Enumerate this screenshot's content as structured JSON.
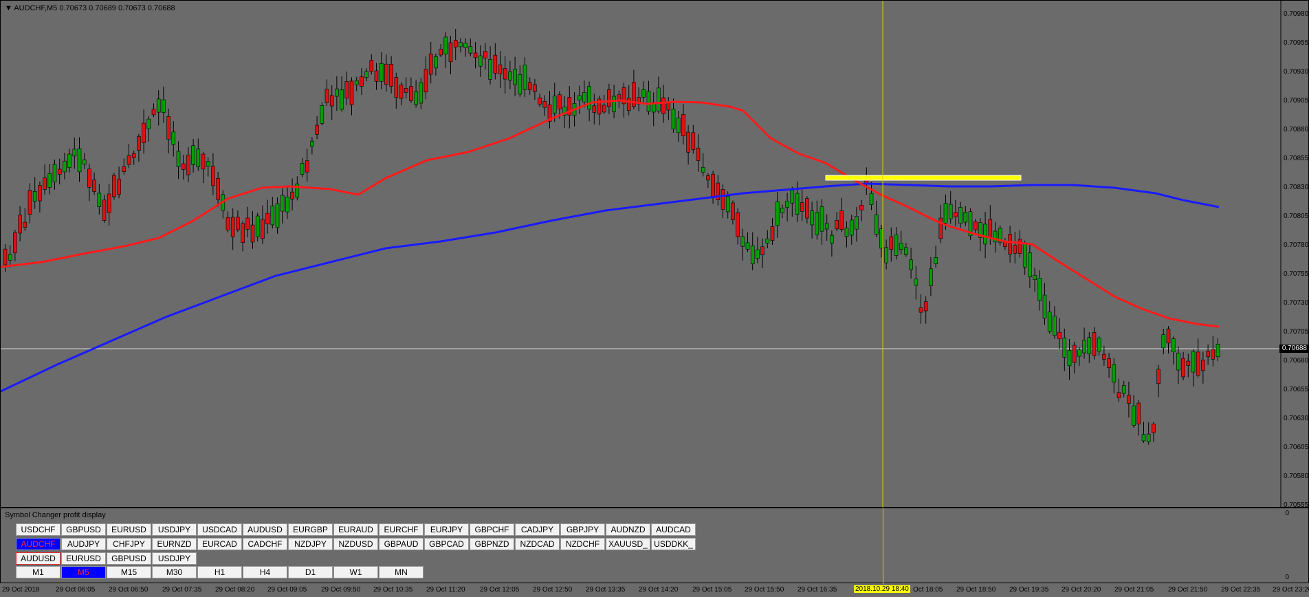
{
  "chart": {
    "title": "AUDCHF,M5  0.70673 0.70689 0.70673 0.70688",
    "price_axis": [
      "0.70980",
      "0.70955",
      "0.70930",
      "0.70905",
      "0.70880",
      "0.70855",
      "0.70830",
      "0.70805",
      "0.70780",
      "0.70755",
      "0.70730",
      "0.70705",
      "0.70680",
      "0.70655",
      "0.70630",
      "0.70605",
      "0.70580",
      "0.70555"
    ],
    "current_price": "0.70688",
    "colors": {
      "background": "#6b6b6b",
      "bull": "#00a000",
      "bear": "#e01010",
      "ma_fast": "#ff1a1a",
      "ma_slow": "#1a1aff",
      "highlight": "#ffff00"
    }
  },
  "panel": {
    "title": "Symbol Changer profit display",
    "scale_top": "0",
    "scale_bottom": "0",
    "row1": [
      "USDCHF",
      "GBPUSD",
      "EURUSD",
      "USDJPY",
      "USDCAD",
      "AUDUSD",
      "EURGBP",
      "EURAUD",
      "EURCHF",
      "EURJPY",
      "GBPCHF",
      "CADJPY",
      "GBPJPY",
      "AUDNZD",
      "AUDCAD"
    ],
    "row2": [
      "AUDCHF",
      "AUDJPY",
      "CHFJPY",
      "EURNZD",
      "EURCAD",
      "CADCHF",
      "NZDJPY",
      "NZDUSD",
      "GBPAUD",
      "GBPCAD",
      "GBPNZD",
      "NZDCAD",
      "NZDCHF",
      "XAUUSD_",
      "USDDKK_"
    ],
    "row3": [
      "AUDUSD",
      "EURUSD",
      "GBPUSD",
      "USDJPY"
    ],
    "timeframes": [
      "M1",
      "M5",
      "M15",
      "M30",
      "H1",
      "H4",
      "D1",
      "W1",
      "MN"
    ],
    "selected_symbol": "AUDCHF",
    "selected_timeframe": "M5"
  },
  "time_axis": {
    "labels": [
      "29 Oct 2018",
      "29 Oct 06:05",
      "29 Oct 06:50",
      "29 Oct 07:35",
      "29 Oct 08:20",
      "29 Oct 09:05",
      "29 Oct 09:50",
      "29 Oct 10:35",
      "29 Oct 11:20",
      "29 Oct 12:05",
      "29 Oct 12:50",
      "29 Oct 13:35",
      "29 Oct 14:20",
      "29 Oct 15:05",
      "29 Oct 15:50",
      "29 Oct 16:35",
      "Oct 18:05",
      "29 Oct 18:50",
      "29 Oct 19:35",
      "29 Oct 20:20",
      "29 Oct 21:05",
      "29 Oct 21:50",
      "29 Oct 22:35",
      "29 Oct 23:20"
    ],
    "crosshair_label": "2018.10.29 18:40"
  }
}
